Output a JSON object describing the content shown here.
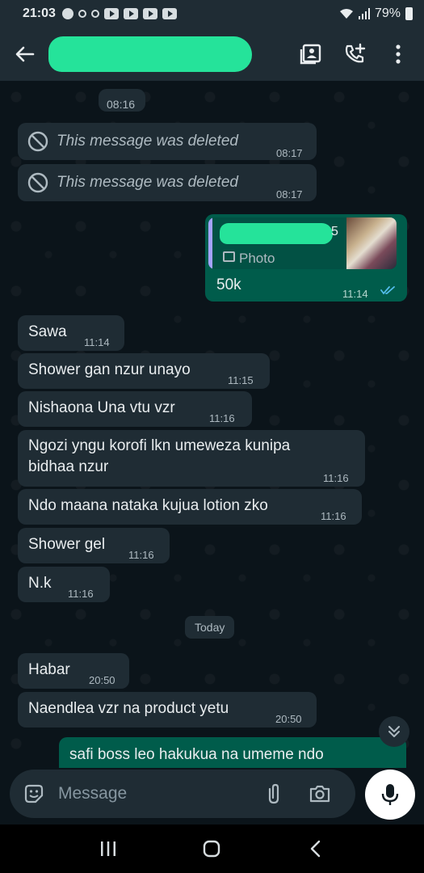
{
  "status_bar": {
    "time": "21:03",
    "battery": "79%"
  },
  "header": {
    "contact_name_redacted": true
  },
  "chat": {
    "messages": [
      {
        "text": "08:16"
      },
      {
        "text": "This message was deleted",
        "time": "08:17"
      },
      {
        "text": "This message was deleted",
        "time": "08:17"
      },
      {
        "quote_label": "Photo",
        "quote_suffix": "5",
        "text": "50k",
        "time": "11:14"
      },
      {
        "text": "Sawa",
        "time": "11:14"
      },
      {
        "text": "Shower gan nzur unayo",
        "time": "11:15"
      },
      {
        "text": "Nishaona Una vtu vzr",
        "time": "11:16"
      },
      {
        "text_line1": "Ngozi yngu korofi lkn umeweza kunipa",
        "text_line2": "bidhaa nzur",
        "time": "11:16"
      },
      {
        "text": "Ndo maana nataka kujua lotion zko",
        "time": "11:16"
      },
      {
        "text": "Shower gel",
        "time": "11:16"
      },
      {
        "text": "N.k",
        "time": "11:16"
      },
      {
        "text": "Today"
      },
      {
        "text": "Habar",
        "time": "20:50"
      },
      {
        "text": "Naendlea vzr na product yetu",
        "time": "20:50"
      },
      {
        "text": "safi boss leo hakukua na umeme ndo"
      }
    ]
  },
  "composer": {
    "placeholder": "Message"
  },
  "colors": {
    "incoming_bubble": "#1f2c34",
    "outgoing_bubble": "#005c4b",
    "background": "#0b141a",
    "read_ticks": "#53bdeb",
    "redaction": "#25e39a"
  }
}
